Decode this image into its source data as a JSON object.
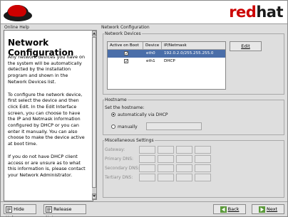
{
  "header": {
    "brand_red": "red",
    "brand_dark": "hat"
  },
  "help_pane": {
    "label": "Online Help",
    "title": "Network Configuration",
    "paragraphs": [
      "Any network devices you have on the system will be automatically detected by the installation program and shown in the Network Devices list.",
      "To configure the network device, first select the device and then click Edit. In the Edit Interface screen, you can choose to have the IP and Netmask information configured by DHCP or you can enter it manually. You can also choose to make the device active at boot time.",
      "If you do not have DHCP client access or are unsure as to what this information is, please contact your Network Administrator."
    ]
  },
  "main": {
    "label": "Network Configuration",
    "devices": {
      "legend": "Network Devices",
      "columns": [
        "Active on Boot",
        "Device",
        "IP/Netmask"
      ],
      "rows": [
        {
          "active": true,
          "device": "eth0",
          "ip": "192.0.2.0/255.255.255.0",
          "selected": true
        },
        {
          "active": true,
          "device": "eth1",
          "ip": "DHCP",
          "selected": false
        }
      ],
      "edit_label": "Edit"
    },
    "hostname": {
      "legend": "Hostname",
      "prompt": "Set the hostname:",
      "option_auto": "automatically via DHCP",
      "option_manual": "manually",
      "manual_value": ""
    },
    "misc": {
      "legend": "Miscellaneous Settings",
      "labels": [
        "Gateway:",
        "Primary DNS:",
        "Secondary DNS:",
        "Tertiary DNS:"
      ]
    }
  },
  "footer": {
    "hide_help": "Hide Help",
    "release_notes": "Release Notes",
    "back": "Back",
    "next": "Next"
  },
  "colors": {
    "accent": "#cc0000",
    "selection": "#4a6ea9"
  }
}
